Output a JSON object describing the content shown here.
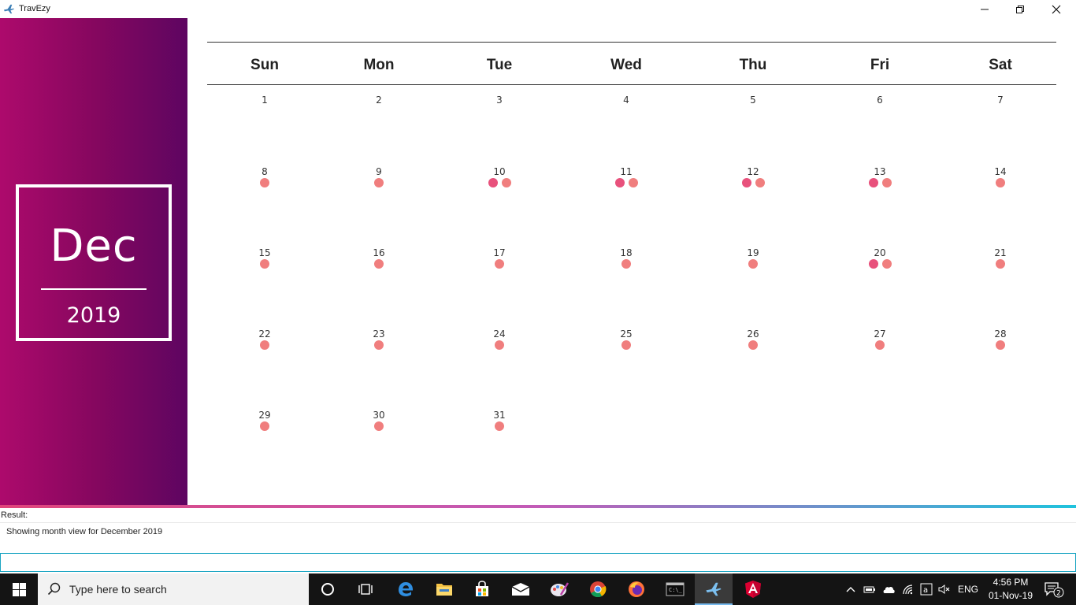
{
  "window": {
    "title": "TravEzy",
    "controls": [
      "minimize-icon",
      "restore-icon",
      "close-icon"
    ]
  },
  "sidebar": {
    "month": "Dec",
    "year": "2019",
    "gradient": [
      "#ad0a6c",
      "#5e0561"
    ]
  },
  "calendar": {
    "weekdays": [
      "Sun",
      "Mon",
      "Tue",
      "Wed",
      "Thu",
      "Fri",
      "Sat"
    ],
    "weeks": [
      [
        {
          "day": "1",
          "events": []
        },
        {
          "day": "2",
          "events": []
        },
        {
          "day": "3",
          "events": []
        },
        {
          "day": "4",
          "events": []
        },
        {
          "day": "5",
          "events": []
        },
        {
          "day": "6",
          "events": []
        },
        {
          "day": "7",
          "events": []
        }
      ],
      [
        {
          "day": "8",
          "events": [
            "light"
          ]
        },
        {
          "day": "9",
          "events": [
            "light"
          ]
        },
        {
          "day": "10",
          "events": [
            "dark",
            "light"
          ]
        },
        {
          "day": "11",
          "events": [
            "dark",
            "light"
          ]
        },
        {
          "day": "12",
          "events": [
            "dark",
            "light"
          ]
        },
        {
          "day": "13",
          "events": [
            "dark",
            "light"
          ]
        },
        {
          "day": "14",
          "events": [
            "light"
          ]
        }
      ],
      [
        {
          "day": "15",
          "events": [
            "light"
          ]
        },
        {
          "day": "16",
          "events": [
            "light"
          ]
        },
        {
          "day": "17",
          "events": [
            "light"
          ]
        },
        {
          "day": "18",
          "events": [
            "light"
          ]
        },
        {
          "day": "19",
          "events": [
            "light"
          ]
        },
        {
          "day": "20",
          "events": [
            "dark",
            "light"
          ]
        },
        {
          "day": "21",
          "events": [
            "light"
          ]
        }
      ],
      [
        {
          "day": "22",
          "events": [
            "light"
          ]
        },
        {
          "day": "23",
          "events": [
            "light"
          ]
        },
        {
          "day": "24",
          "events": [
            "light"
          ]
        },
        {
          "day": "25",
          "events": [
            "light"
          ]
        },
        {
          "day": "26",
          "events": [
            "light"
          ]
        },
        {
          "day": "27",
          "events": [
            "light"
          ]
        },
        {
          "day": "28",
          "events": [
            "light"
          ]
        }
      ],
      [
        {
          "day": "29",
          "events": [
            "light"
          ]
        },
        {
          "day": "30",
          "events": [
            "light"
          ]
        },
        {
          "day": "31",
          "events": [
            "light"
          ]
        }
      ]
    ],
    "event_colors": {
      "light": "#f07e7e",
      "dark": "#e8517c"
    }
  },
  "result": {
    "label": "Result:",
    "text": "Showing month view for December 2019",
    "input_value": ""
  },
  "taskbar": {
    "search_placeholder": "Type here to search",
    "apps": [
      "cortana-icon",
      "task-view-icon",
      "edge-icon",
      "file-explorer-icon",
      "store-icon",
      "mail-icon",
      "paint-icon",
      "chrome-icon",
      "firefox-icon",
      "terminal-icon",
      "travezy-icon",
      "angular-icon"
    ],
    "language": "ENG",
    "time": "4:56 PM",
    "date": "01-Nov-19",
    "notification_count": "2"
  }
}
